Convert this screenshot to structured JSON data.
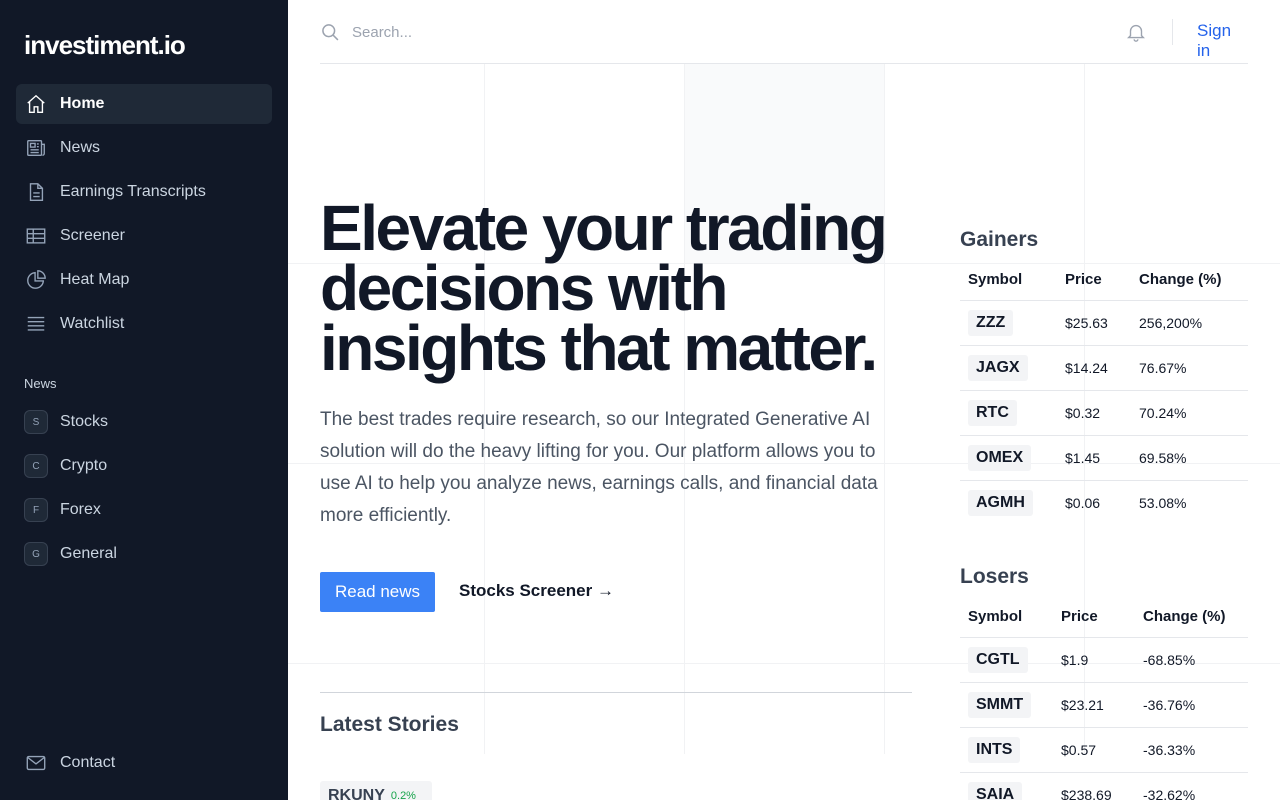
{
  "brand": "investiment.io",
  "sidebar": {
    "nav": [
      {
        "label": "Home",
        "icon": "home-icon"
      },
      {
        "label": "News",
        "icon": "newspaper-icon"
      },
      {
        "label": "Earnings Transcripts",
        "icon": "document-icon"
      },
      {
        "label": "Screener",
        "icon": "table-icon"
      },
      {
        "label": "Heat Map",
        "icon": "pie-chart-icon"
      },
      {
        "label": "Watchlist",
        "icon": "list-icon"
      }
    ],
    "section_heading": "News",
    "news_categories": [
      {
        "letter": "S",
        "label": "Stocks"
      },
      {
        "letter": "C",
        "label": "Crypto"
      },
      {
        "letter": "F",
        "label": "Forex"
      },
      {
        "letter": "G",
        "label": "General"
      }
    ],
    "contact": "Contact"
  },
  "topbar": {
    "search_placeholder": "Search...",
    "sign_in": "Sign in"
  },
  "hero": {
    "title": "Elevate your trading decisions with insights that matter.",
    "description": "The best trades require research, so our Integrated Generative AI solution will do the heavy lifting for you. Our platform allows you to use AI to help you analyze news, earnings calls, and financial data more efficiently.",
    "primary_button": "Read news",
    "secondary_link": "Stocks Screener →"
  },
  "latest_stories": {
    "title": "Latest Stories",
    "first_symbol": "RKUNY",
    "first_change": "0.2%"
  },
  "gainers": {
    "title": "Gainers",
    "columns": [
      "Symbol",
      "Price",
      "Change (%)"
    ],
    "rows": [
      {
        "symbol": "ZZZ",
        "price": "$25.63",
        "change": "256,200%"
      },
      {
        "symbol": "JAGX",
        "price": "$14.24",
        "change": "76.67%"
      },
      {
        "symbol": "RTC",
        "price": "$0.32",
        "change": "70.24%"
      },
      {
        "symbol": "OMEX",
        "price": "$1.45",
        "change": "69.58%"
      },
      {
        "symbol": "AGMH",
        "price": "$0.06",
        "change": "53.08%"
      }
    ]
  },
  "losers": {
    "title": "Losers",
    "columns": [
      "Symbol",
      "Price",
      "Change (%)"
    ],
    "rows": [
      {
        "symbol": "CGTL",
        "price": "$1.9",
        "change": "-68.85%"
      },
      {
        "symbol": "SMMT",
        "price": "$23.21",
        "change": "-36.76%"
      },
      {
        "symbol": "INTS",
        "price": "$0.57",
        "change": "-36.33%"
      },
      {
        "symbol": "SAIA",
        "price": "$238.69",
        "change": "-32.62%"
      }
    ]
  },
  "colors": {
    "sidebar_bg": "#111827",
    "accent": "#3b82f6",
    "link": "#2563eb",
    "gain": "#16a34a",
    "loss": "#dc2626"
  }
}
